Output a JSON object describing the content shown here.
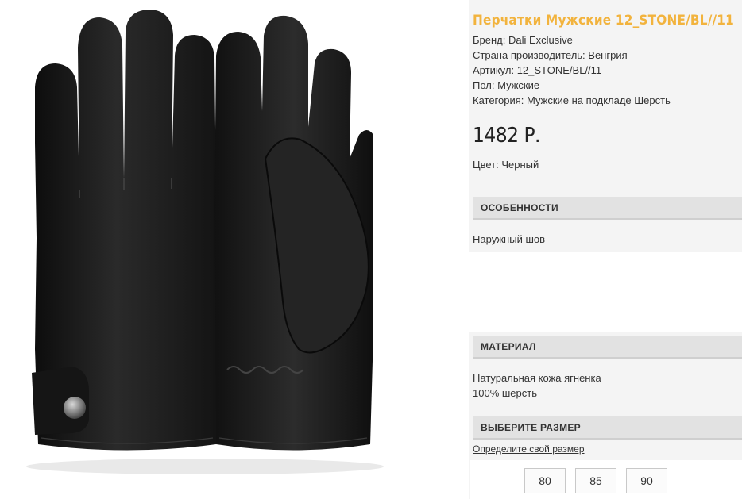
{
  "product": {
    "title": "Перчатки Мужские 12_STONE/BL//11",
    "properties": [
      "Бренд: Dali Exclusive",
      "Страна производитель: Венгрия",
      "Артикул: 12_STONE/BL//11",
      "Пол: Мужские",
      "Категория: Мужские на подкладе Шерсть"
    ],
    "price": "1482 Р.",
    "color": "Цвет: Черный"
  },
  "sections": {
    "features_title": "ОСОБЕННОСТИ",
    "features_text": "Наружный шов",
    "material_title": "МАТЕРИАЛ",
    "material_lines": [
      "Натуральная кожа ягненка",
      "100% шерсть"
    ],
    "size_title": "ВЫБЕРИТЕ РАЗМЕР",
    "size_link": "Определите свой размер"
  },
  "sizes": [
    "80",
    "85",
    "90"
  ],
  "colors": {
    "title": "#f2b33d",
    "section_bg": "#e2e2e2",
    "glove": "#1c1c1c"
  },
  "image": {
    "icon": "leather-gloves-photo"
  }
}
